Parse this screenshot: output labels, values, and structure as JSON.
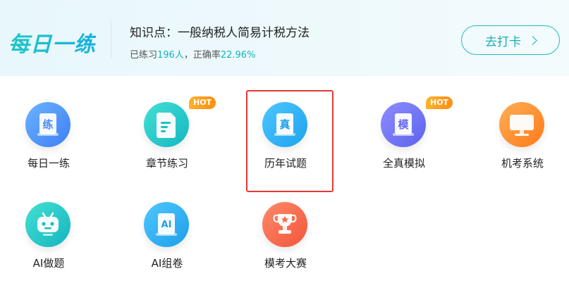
{
  "banner": {
    "brand": "每日一练",
    "knowledge_title": "知识点：一般纳税人简易计税方法",
    "stats_prefix": "已练习",
    "stats_count": "196人",
    "stats_middle": "，正确率",
    "stats_rate": "22.96%",
    "checkin_label": "去打卡"
  },
  "badge_hot": "HOT",
  "grid": [
    {
      "label": "每日一练",
      "glyph": "练",
      "icon": "practice-book-icon"
    },
    {
      "label": "章节练习",
      "glyph": "",
      "icon": "document-icon"
    },
    {
      "label": "历年试题",
      "glyph": "真",
      "icon": "exam-book-icon"
    },
    {
      "label": "全真模拟",
      "glyph": "模",
      "icon": "mock-book-icon"
    },
    {
      "label": "机考系统",
      "glyph": "",
      "icon": "monitor-icon"
    },
    {
      "label": "AI做题",
      "glyph": "",
      "icon": "robot-icon"
    },
    {
      "label": "AI组卷",
      "glyph": "AI",
      "icon": "ai-book-icon"
    },
    {
      "label": "模考大赛",
      "glyph": "",
      "icon": "trophy-icon"
    }
  ],
  "colors": {
    "accent": "#1ec3c9",
    "hot": "#ff9a1a",
    "highlight": "#e53935"
  }
}
